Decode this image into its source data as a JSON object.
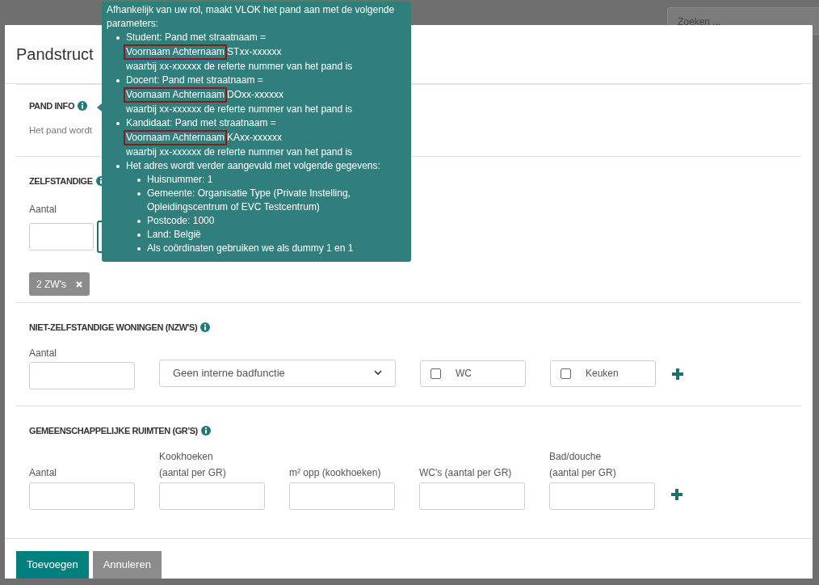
{
  "background": {
    "search": {
      "placeholder": "Zoeken ..."
    }
  },
  "modal": {
    "title": "Pandstruct",
    "sections": [
      {
        "kind": "info",
        "heading": "PAND INFO",
        "text_left": "Het pand wordt"
      },
      {
        "kind": "zw",
        "heading": "ZELFSTANDIGE",
        "label": "Aantal",
        "tag": "2 ZW's"
      },
      {
        "kind": "nzw",
        "heading": "NIET-ZELFSTANDIGE WONINGEN (NZW'S)",
        "label": "Aantal",
        "select": "Geen interne badfunctie",
        "checkboxes": [
          {
            "label": "WC",
            "checked": false
          },
          {
            "label": "Keuken",
            "checked": false
          }
        ]
      },
      {
        "kind": "gr",
        "heading": "GEMEENSCHAPPELIJKE RUIMTEN (GR'S)",
        "fields": [
          {
            "label": [
              "Aantal"
            ]
          },
          {
            "label": [
              "Kookhoeken",
              "(aantal per GR)"
            ]
          },
          {
            "label": [
              "m² opp (kookhoeken)"
            ]
          },
          {
            "label": [
              "WC's (aantal per GR)"
            ]
          },
          {
            "label": [
              "Bad/douche",
              "(aantal per GR)"
            ]
          }
        ]
      }
    ],
    "buttons": [
      {
        "label": "Toevoegen",
        "kind": "primary"
      },
      {
        "label": "Annuleren",
        "kind": "secondary"
      }
    ]
  },
  "tooltip": {
    "intro": "Afhankelijk van uw rol, maakt VLOK het pand aan met de volgende parameters:",
    "items": [
      {
        "role": "Student: Pand met straatnaam =",
        "highlight": "Voornaam Achternaam",
        "code": "STxx-xxxxxx",
        "note": "waarbij xx-xxxxxx de referte nummer van het pand is"
      },
      {
        "role": "Docent: Pand met straatnaam =",
        "highlight": "Voornaam Achternaam",
        "code": "DOxx-xxxxxx",
        "note": "waarbij xx-xxxxxx de referte nummer van het pand is"
      },
      {
        "role": "Kandidaat: Pand met straatnaam =",
        "highlight": "Voornaam Achternaam",
        "code": "KAxx-xxxxxx",
        "note": "waarbij xx-xxxxxx de referte nummer van het pand is"
      }
    ],
    "address": {
      "text": "Het adres wordt verder aangevuld met volgende gegevens:",
      "children": [
        "Huisnummer: 1",
        "Gemeente: Organisatie Type (Private Instelling, Opleidingscentrum of EVC Testcentrum)",
        "Postcode: 1000",
        "Land: België",
        "Als coördinaten gebruiken we als dummy 1 en 1"
      ]
    }
  }
}
